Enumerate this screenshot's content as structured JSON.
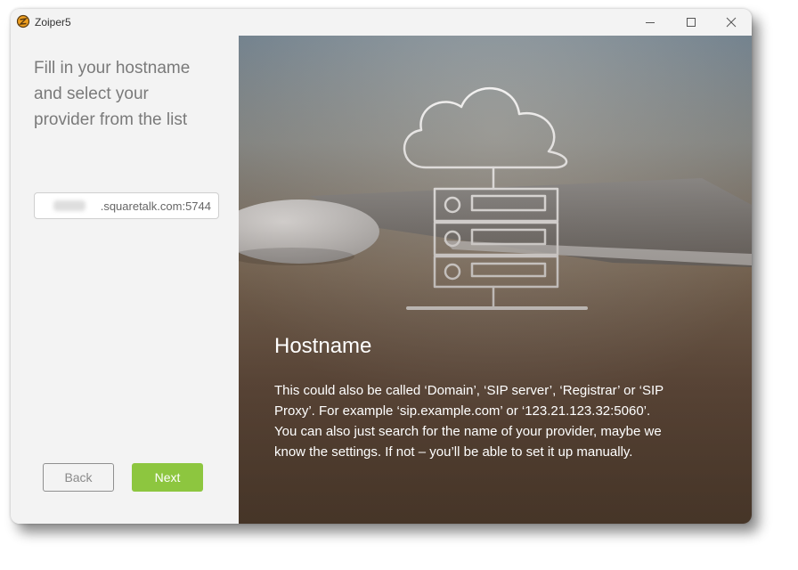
{
  "window": {
    "title": "Zoiper5",
    "controls": [
      "minimize-icon",
      "maximize-icon",
      "close-icon"
    ]
  },
  "left": {
    "heading": " Fill in your hostname\nand select your\nprovider from the list",
    "hostname_input": {
      "value": ".squaretalk.com:5744"
    },
    "back_label": "Back",
    "next_label": "Next"
  },
  "right": {
    "illustration": "cloud-server-icon",
    "info_title": "Hostname",
    "info_paragraph1": " This could also be called ‘Domain’, ‘SIP server’, ‘Registrar’ or ‘SIP Proxy’. For example ‘sip.example.com’ or ‘123.21.123.32:5060’.",
    "info_paragraph2": "You can also just search for the name of your provider, maybe we know the settings. If not – you’ll be able to set it up manually."
  },
  "colors": {
    "accent_green": "#8dc63f",
    "left_panel_bg": "#f3f3f3",
    "heading_text": "#7a7a7a"
  }
}
